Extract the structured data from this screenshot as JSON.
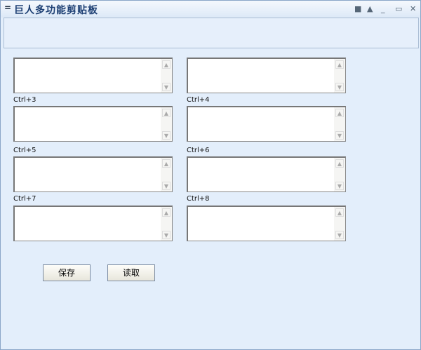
{
  "window": {
    "title": "巨人多功能剪贴板",
    "menu_glyph": "="
  },
  "title_buttons": [
    {
      "name": "menu",
      "glyph": "■"
    },
    {
      "name": "rollup",
      "glyph": "▲"
    },
    {
      "name": "minimize",
      "glyph": "_"
    },
    {
      "name": "maximize",
      "glyph": "▭"
    },
    {
      "name": "close",
      "glyph": "✕"
    }
  ],
  "labels": [
    "Ctrl+3",
    "Ctrl+4",
    "Ctrl+5",
    "Ctrl+6",
    "Ctrl+7",
    "Ctrl+8"
  ],
  "buttons": {
    "save": "保存",
    "read": "读取"
  }
}
